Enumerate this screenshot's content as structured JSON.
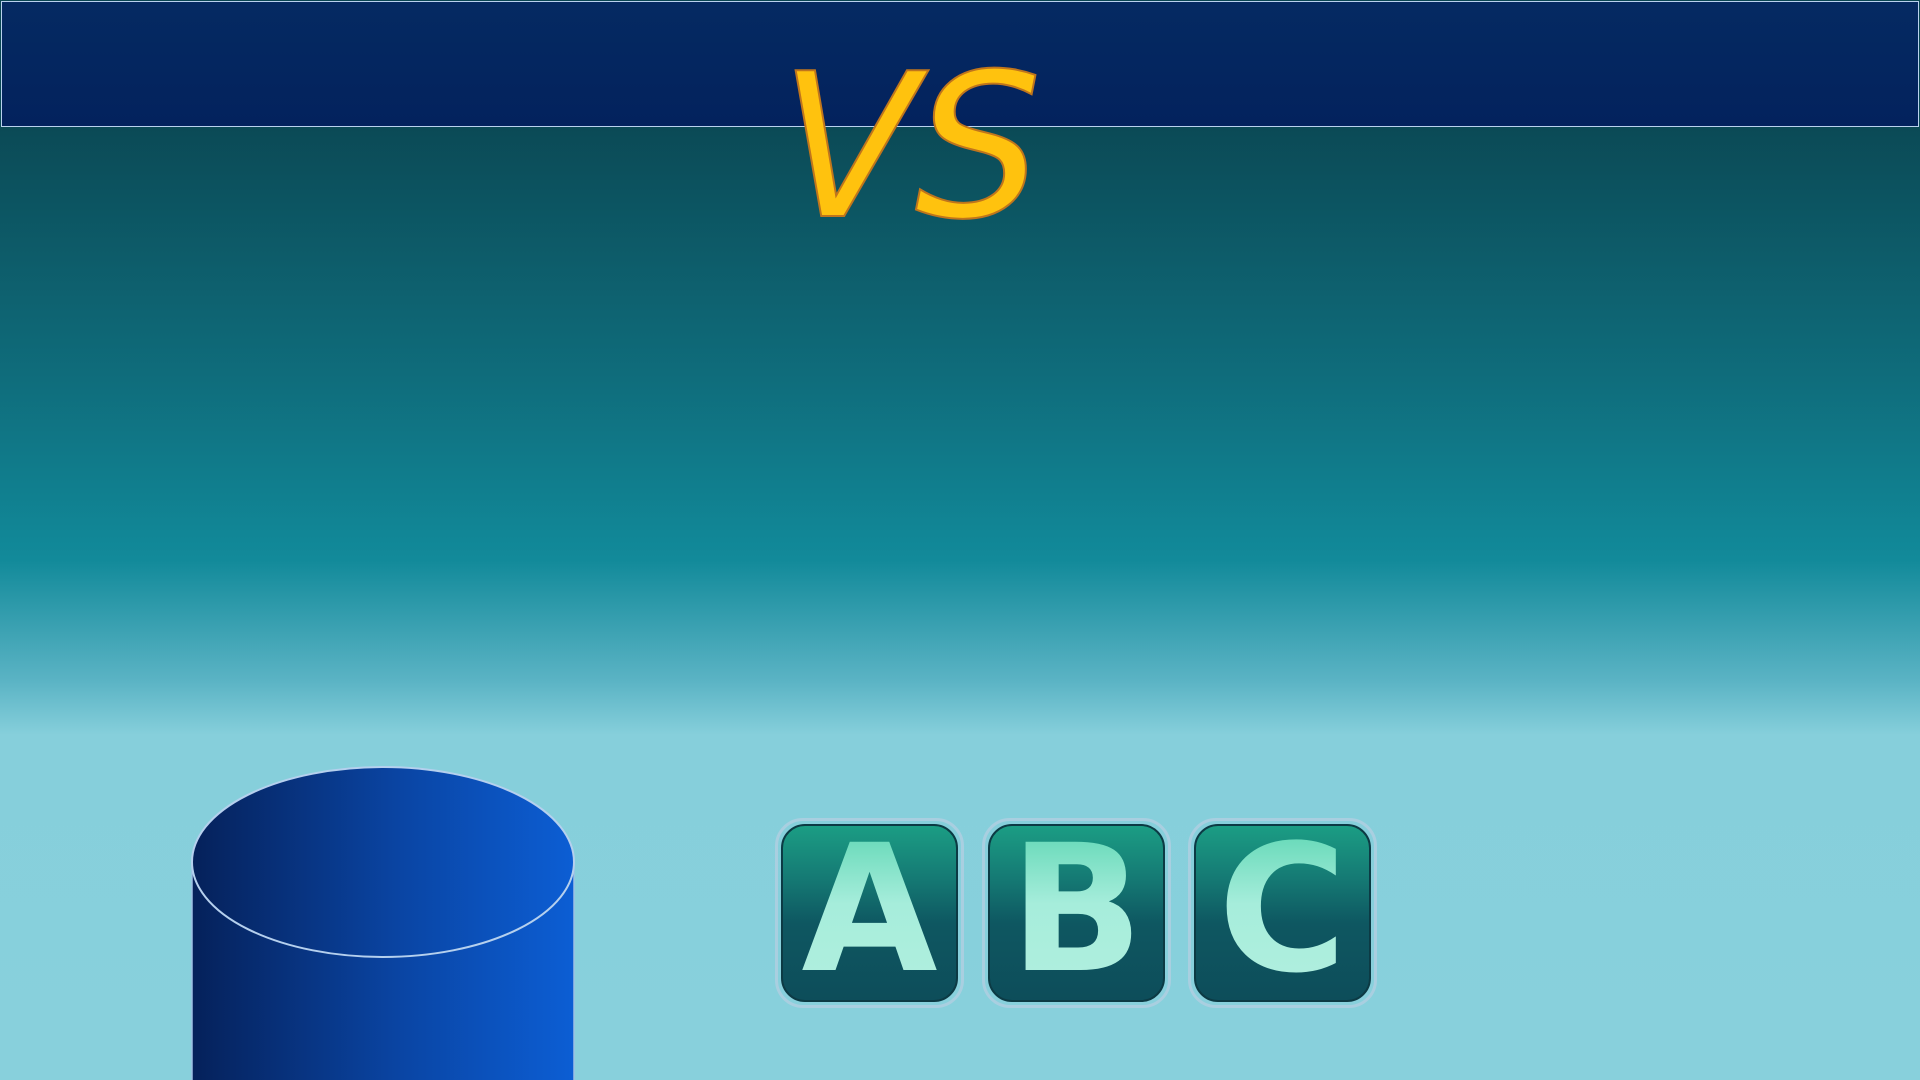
{
  "header": {
    "title": "VS"
  },
  "letter_tiles": [
    {
      "letter": "A"
    },
    {
      "letter": "B"
    },
    {
      "letter": "C"
    }
  ],
  "colors": {
    "top_bar": "#03225d",
    "title": "#ffc20e",
    "title_outline": "#c0751c",
    "tile_letter": "#a9ecd8",
    "cylinder_left": "#05215a",
    "cylinder_right": "#0c5ed4"
  }
}
